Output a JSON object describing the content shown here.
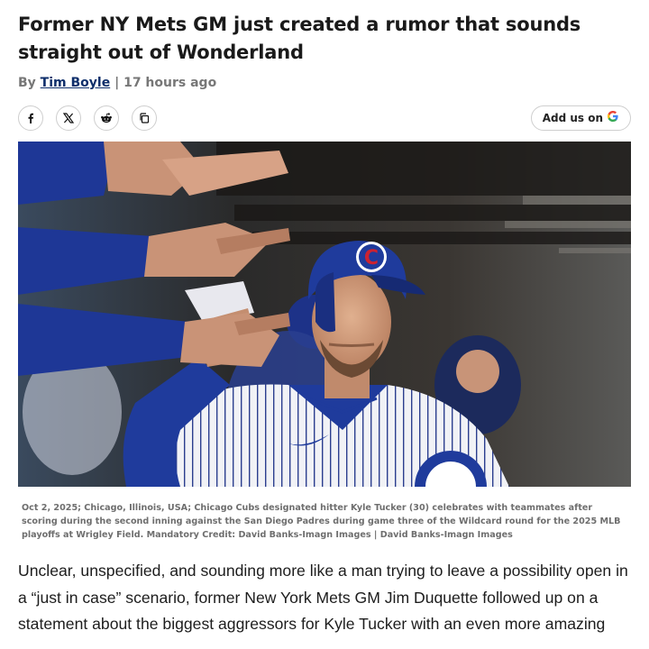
{
  "article": {
    "headline": "Former NY Mets GM just created a rumor that sounds straight out of Wonderland",
    "byline_prefix": "By",
    "author": "Tim Boyle",
    "byline_separator": "|",
    "time_ago": "17 hours ago"
  },
  "share": {
    "buttons": [
      {
        "icon": "facebook-icon"
      },
      {
        "icon": "x-icon"
      },
      {
        "icon": "reddit-icon"
      },
      {
        "icon": "copy-link-icon"
      }
    ],
    "google_label": "Add us on",
    "google_letter": "G"
  },
  "photo": {
    "jersey_logo": "C",
    "caption": "Oct 2, 2025; Chicago, Illinois, USA; Chicago Cubs designated hitter Kyle Tucker (30) celebrates with teammates after scoring during the second inning against the San Diego Padres during game three of the Wildcard round for the 2025 MLB playoffs at Wrigley Field. Mandatory Credit: David Banks-Imagn Images | David Banks-Imagn Images"
  },
  "body": {
    "paragraph": "Unclear, unspecified, and sounding more like a man trying to leave a possibility open in a “just in case” scenario, former New York Mets GM Jim Duquette followed up on a statement about the biggest aggressors for Kyle Tucker with an even more amazing"
  },
  "colors": {
    "author_link": "#0f2f6b",
    "cubs_blue": "#1f3b9c",
    "cubs_red": "#cc2230"
  }
}
